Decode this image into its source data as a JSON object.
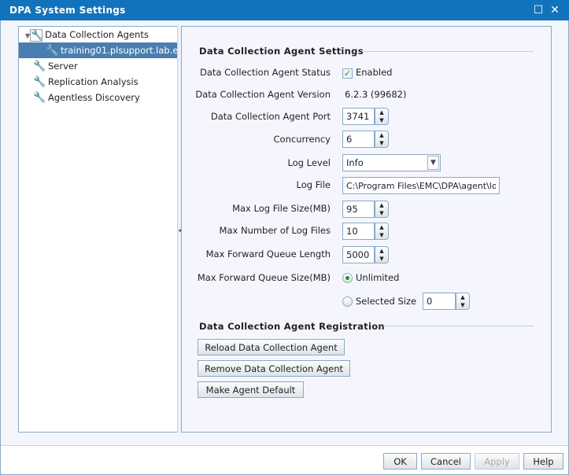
{
  "window": {
    "title": "DPA System Settings",
    "maximize_icon": "maximize-icon",
    "close_icon": "close-icon"
  },
  "tree": {
    "items": [
      {
        "label": "Data Collection Agents",
        "icon": "tools-icon"
      },
      {
        "label": "training01.plsupport.lab.e",
        "icon": "agent-ok-icon"
      },
      {
        "label": "Server",
        "icon": "tools-icon"
      },
      {
        "label": "Replication Analysis",
        "icon": "tools-icon"
      },
      {
        "label": "Agentless Discovery",
        "icon": "tools-icon"
      }
    ]
  },
  "settings": {
    "heading": "Data Collection Agent Settings",
    "status_label": "Data Collection Agent Status",
    "status_value": "Enabled",
    "version_label": "Data Collection Agent Version",
    "version_value": "6.2.3 (99682)",
    "port_label": "Data Collection Agent Port",
    "port_value": "3741",
    "concurrency_label": "Concurrency",
    "concurrency_value": "6",
    "loglevel_label": "Log Level",
    "loglevel_value": "Info",
    "logfile_label": "Log File",
    "logfile_value": "C:\\Program Files\\EMC\\DPA\\agent\\logs",
    "maxlogsize_label": "Max Log File Size(MB)",
    "maxlogsize_value": "95",
    "maxlogfiles_label": "Max Number of Log Files",
    "maxlogfiles_value": "10",
    "queuelen_label": "Max Forward Queue Length",
    "queuelen_value": "5000",
    "queuesize_label": "Max Forward Queue Size(MB)",
    "unlimited_label": "Unlimited",
    "selected_label": "Selected Size",
    "selected_value": "0"
  },
  "registration": {
    "heading": "Data Collection Agent Registration",
    "reload": "Reload Data Collection Agent",
    "remove": "Remove Data Collection Agent",
    "default": "Make Agent Default"
  },
  "footer": {
    "ok": "OK",
    "cancel": "Cancel",
    "apply": "Apply",
    "help": "Help"
  }
}
